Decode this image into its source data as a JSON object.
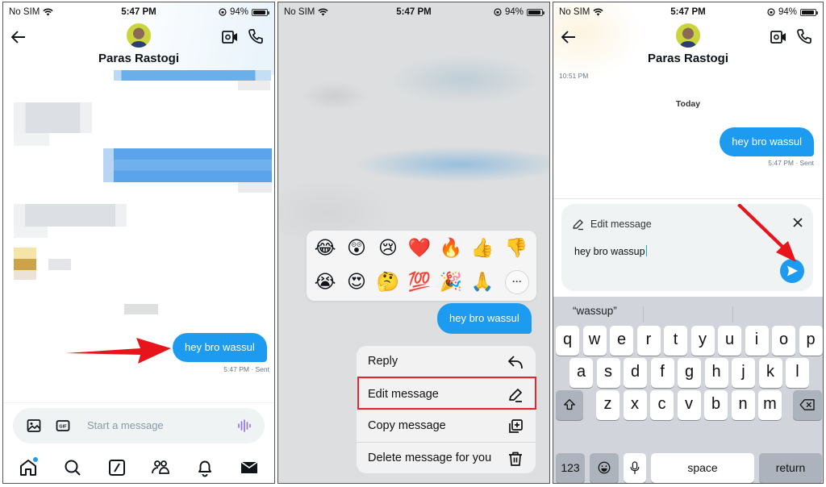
{
  "status_bar": {
    "carrier": "No SIM",
    "time": "5:47 PM",
    "battery": "94%",
    "battery_level": 0.94
  },
  "contact": {
    "name": "Paras Rastogi"
  },
  "panel1": {
    "sent_message": "hey bro wassul",
    "sent_meta": "5:47 PM · Sent",
    "composer_placeholder": "Start a message",
    "tabs": [
      "home",
      "search",
      "communities",
      "people",
      "notifications",
      "messages"
    ]
  },
  "panel2": {
    "reactions_row1": [
      "😂",
      "😲",
      "😢",
      "❤️",
      "🔥",
      "👍",
      "👎"
    ],
    "reactions_row2": [
      "😭",
      "😍",
      "🤔",
      "💯",
      "🎉",
      "🙏"
    ],
    "more_label": "···",
    "message": "hey bro wassul",
    "menu": [
      {
        "label": "Reply",
        "icon": "reply-icon"
      },
      {
        "label": "Edit message",
        "icon": "edit-icon",
        "highlighted": true
      },
      {
        "label": "Copy message",
        "icon": "copy-icon"
      },
      {
        "label": "Delete message for you",
        "icon": "trash-icon"
      }
    ]
  },
  "panel3": {
    "earlier_time": "10:51 PM",
    "day_label": "Today",
    "message": "hey bro wassul",
    "message_meta": "5:47 PM · Sent",
    "edit_title": "Edit message",
    "edit_value": "hey bro wassup",
    "suggestion": "“wassup”",
    "keyboard": {
      "row1": [
        "q",
        "w",
        "e",
        "r",
        "t",
        "y",
        "u",
        "i",
        "o",
        "p"
      ],
      "row2": [
        "a",
        "s",
        "d",
        "f",
        "g",
        "h",
        "j",
        "k",
        "l"
      ],
      "row3": [
        "z",
        "x",
        "c",
        "v",
        "b",
        "n",
        "m"
      ],
      "numbers_key": "123",
      "space_key": "space",
      "return_key": "return"
    }
  },
  "colors": {
    "accent": "#1d9bf0",
    "highlight": "#e0262e",
    "arrow": "#e8141b"
  }
}
